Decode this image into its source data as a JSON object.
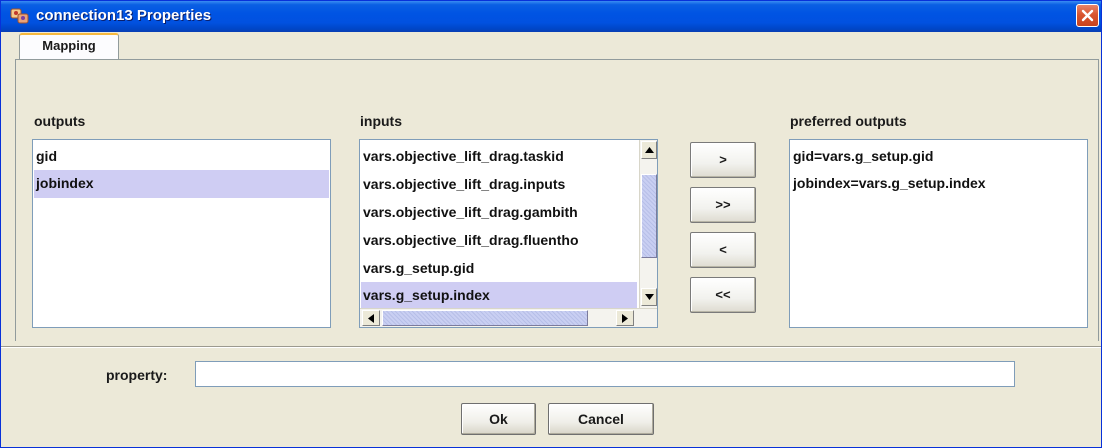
{
  "window": {
    "title": "connection13 Properties"
  },
  "tabs": [
    {
      "label": "Mapping",
      "active": true
    }
  ],
  "outputs": {
    "label": "outputs",
    "items": [
      "gid",
      "jobindex"
    ],
    "selected": "jobindex"
  },
  "inputs": {
    "label": "inputs",
    "items": [
      "vars.objective_lift_drag.taskid",
      "vars.objective_lift_drag.inputs",
      "vars.objective_lift_drag.gambith",
      "vars.objective_lift_drag.fluentho",
      "vars.g_setup.gid",
      "vars.g_setup.index"
    ],
    "selected": "vars.g_setup.index"
  },
  "mapping_buttons": {
    "add": ">",
    "add_all": ">>",
    "remove": "<",
    "remove_all": "<<"
  },
  "preferred_outputs": {
    "label": "preferred outputs",
    "items": [
      "gid=vars.g_setup.gid",
      "jobindex=vars.g_setup.index"
    ]
  },
  "property": {
    "label": "property:",
    "value": ""
  },
  "dialog_buttons": {
    "ok": "Ok",
    "cancel": "Cancel"
  },
  "colors": {
    "titlebar": "#0054e3",
    "selection": "#cfcdf3",
    "close_button": "#d9552f",
    "window_bg": "#ece9d8"
  }
}
